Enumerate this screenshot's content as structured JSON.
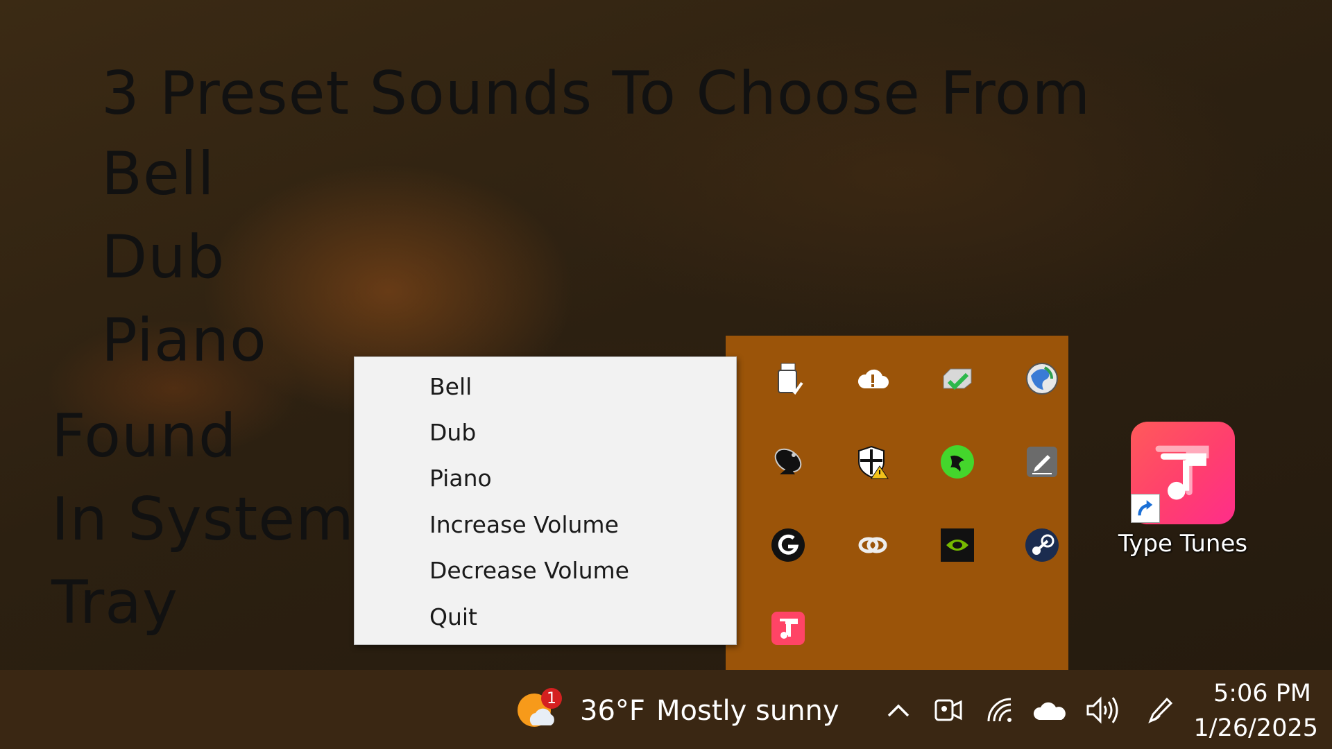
{
  "overlay": {
    "line1": "3 Preset Sounds To Choose From",
    "line2": "Bell",
    "line3": "Dub",
    "line4": "Piano",
    "line5": "Found",
    "line6": "In System",
    "line7": "Tray"
  },
  "context_menu": {
    "items": [
      "Bell",
      "Dub",
      "Piano",
      "Increase Volume",
      "Decrease Volume",
      "Quit"
    ]
  },
  "tray_overflow": {
    "icons": [
      "usb-safely-remove-icon",
      "cloud-warning-icon",
      "network-drive-check-icon",
      "globe-icon",
      "satellite-dish-icon",
      "security-shield-warning-icon",
      "razer-icon",
      "pen-tablet-icon",
      "logitech-g-icon",
      "creative-cloud-icon",
      "nvidia-icon",
      "steam-icon",
      "type-tunes-icon"
    ]
  },
  "desktop": {
    "shortcut_label": "Type Tunes"
  },
  "taskbar": {
    "weather": {
      "temperature": "36°F",
      "condition": "Mostly sunny",
      "badge_count": "1"
    },
    "clock": {
      "time": "5:06 PM",
      "date": "1/26/2025"
    }
  },
  "colors": {
    "tray_background": "#9b5409",
    "menu_background": "#f2f2f2",
    "taskbar_background": "#3a2713",
    "app_accent": "#ff3f6e"
  }
}
